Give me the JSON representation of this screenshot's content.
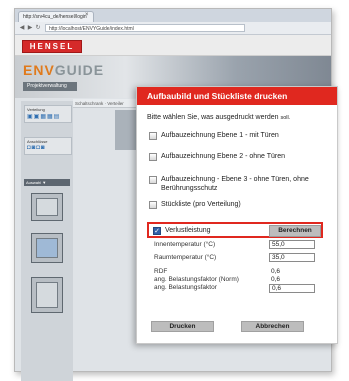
{
  "browser": {
    "tab_title": "http://srv4cu_de/hensel/login",
    "url": "http://localhost/ENVYGuide/index.html"
  },
  "app": {
    "logo": "HENSEL",
    "brand_en": "ENV",
    "brand_rest": "GUIDE",
    "project_button": "Projektverwaltung",
    "sidebar_section1": "Verteilung",
    "sidebar_section2": "Anschlüsse",
    "sidebar_header": "Auswahl ▼",
    "content_tab": "Schaltschrank · Verteiler"
  },
  "dialog": {
    "title": "Aufbaubild und Stückliste drucken",
    "prompt_main": "Bitte wählen Sie, was ausgedruckt werden ",
    "prompt_small": "soll.",
    "options": [
      {
        "label": "Aufbauzeichnung Ebene 1 - mit Türen",
        "checked": false
      },
      {
        "label": "Aufbauzeichnung Ebene 2 - ohne Türen",
        "checked": false
      },
      {
        "label": "Aufbauzeichnung - Ebene 3 - ohne Türen, ohne Berührungsschutz",
        "checked": false
      },
      {
        "label": "Stückliste (pro Verteilung)",
        "checked": false
      }
    ],
    "option3_line1": "Aufbauzeichnung - Ebene 3 - ohne Türen, ohne",
    "option3_line2": "Berührungsschutz",
    "verlust": {
      "label": "Verlustleistung",
      "checked": true,
      "calc_button": "Berechnen"
    },
    "fields": {
      "innentemperatur": {
        "label": "Innentemperatur (°C)",
        "value": "55,0"
      },
      "raumtemperatur": {
        "label": "Raumtemperatur (°C)",
        "value": "35,0"
      },
      "rdf": {
        "label": "RDF",
        "value": "0,6"
      },
      "belastung_norm": {
        "label": "ang. Belastungsfaktor (Norm)",
        "value": "0,6"
      },
      "belastung": {
        "label": "ang. Belastungsfaktor",
        "value": "0,6"
      }
    },
    "print_button": "Drucken",
    "cancel_button": "Abbrechen"
  },
  "colors": {
    "accent_red": "#e0281f",
    "checkbox_on": "#2f5fa8"
  }
}
